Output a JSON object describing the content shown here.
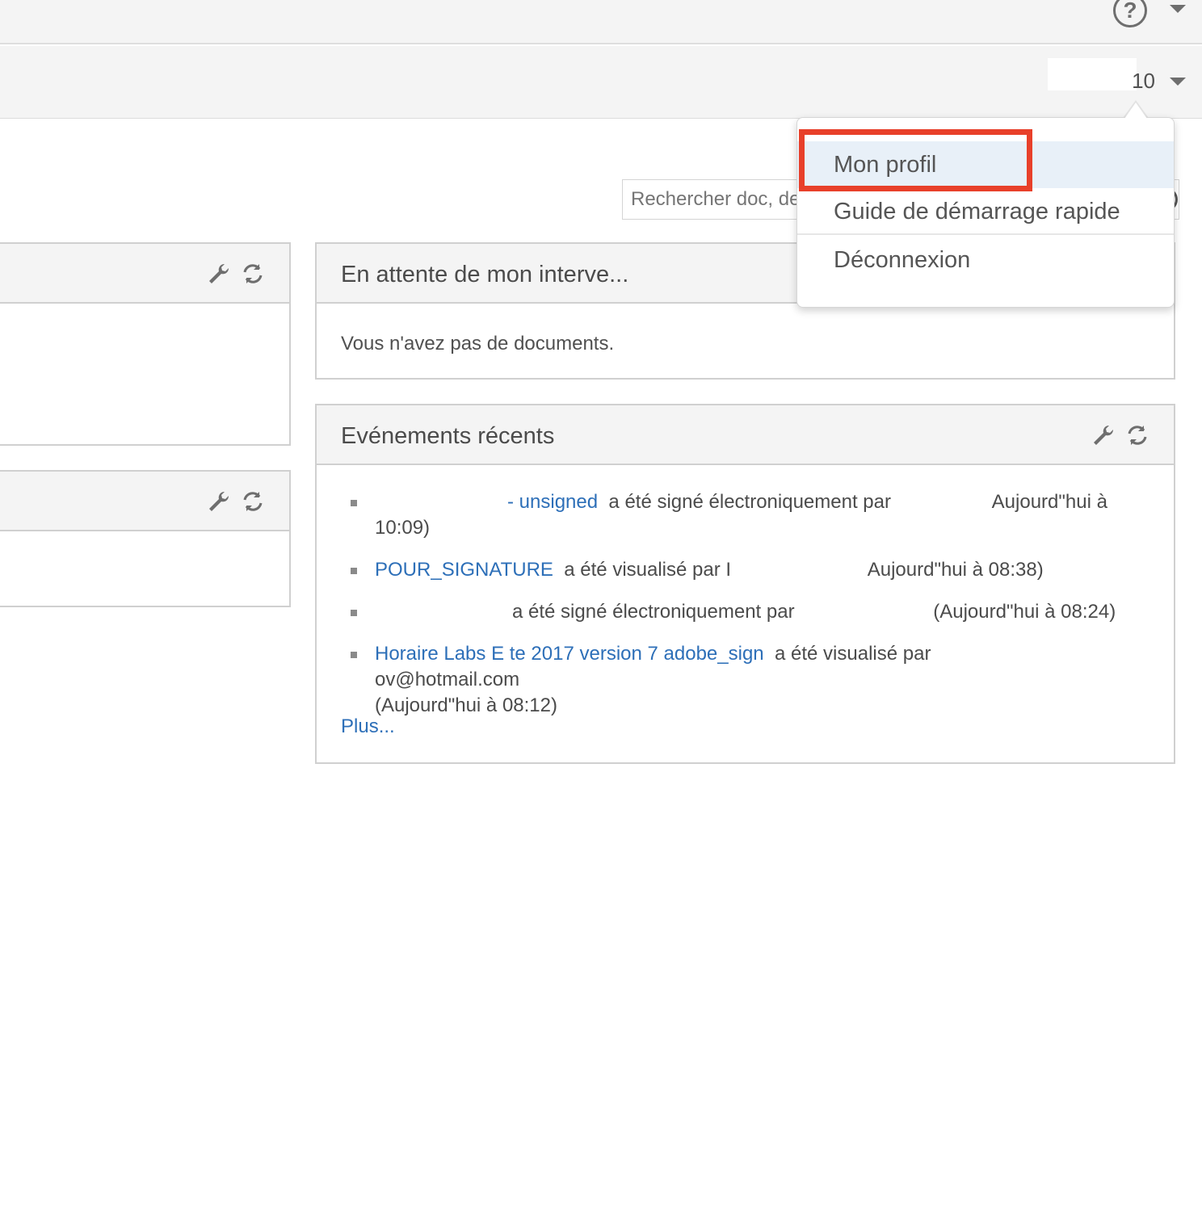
{
  "header": {
    "help_icon": "help-circle-icon",
    "help_symbol": "?",
    "user_name_fragment": "10",
    "caret_icon": "chevron-down-icon"
  },
  "search": {
    "placeholder": "Rechercher doc, des"
  },
  "panels": {
    "waiting": {
      "title": "En attente de mon interve...",
      "empty_message": "Vous n'avez pas de documents."
    },
    "events": {
      "title": "Evénements récents",
      "items": [
        {
          "link": "- unsigned",
          "text": "a été signé électroniquement par",
          "time": "Aujourd\"hui à",
          "time2": "10:09)"
        },
        {
          "link": "POUR_SIGNATURE",
          "text": "a été visualisé par I",
          "time": "Aujourd\"hui à 08:38)"
        },
        {
          "link": "",
          "text": "a été signé électroniquement par",
          "time": "(Aujourd\"hui à 08:24)"
        },
        {
          "link": "Horaire Labs E te 2017 version 7 adobe_sign",
          "text": "a été visualisé par",
          "time": "ov@hotmail.com",
          "time2": "(Aujourd\"hui à 08:12)"
        }
      ],
      "more_link": "Plus..."
    },
    "icons": {
      "settings": "wrench-icon",
      "refresh": "refresh-icon"
    }
  },
  "dropdown": {
    "items": [
      "Mon profil",
      "Guide de démarrage rapide",
      "Déconnexion"
    ],
    "highlight_color": "#e8402a"
  },
  "colors": {
    "link": "#2d6fb8",
    "header_bg": "#f4f4f4"
  }
}
